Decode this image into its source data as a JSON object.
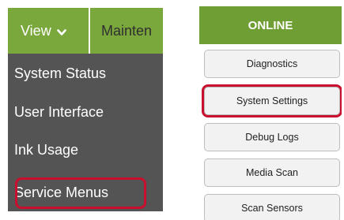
{
  "view_menu": {
    "menubar": {
      "view_label": "View",
      "maintenance_label": "Mainten"
    },
    "dropdown_items": [
      {
        "label": "System Status"
      },
      {
        "label": "User Interface"
      },
      {
        "label": "Ink Usage"
      },
      {
        "label": "Service Menus",
        "highlighted": true
      }
    ]
  },
  "service_panel": {
    "header": "ONLINE",
    "buttons": [
      {
        "label": "Diagnostics"
      },
      {
        "label": "System Settings",
        "highlighted": true
      },
      {
        "label": "Debug Logs"
      },
      {
        "label": "Media Scan"
      },
      {
        "label": "Scan Sensors"
      }
    ]
  },
  "colors": {
    "menubar_green": "#7aa83d",
    "header_green": "#6f9e35",
    "dropdown_gray": "#545454",
    "highlight_red": "#c8102e",
    "button_bg": "#f2f2f2"
  },
  "icons": {
    "view_dropdown": "chevron-down-icon"
  }
}
